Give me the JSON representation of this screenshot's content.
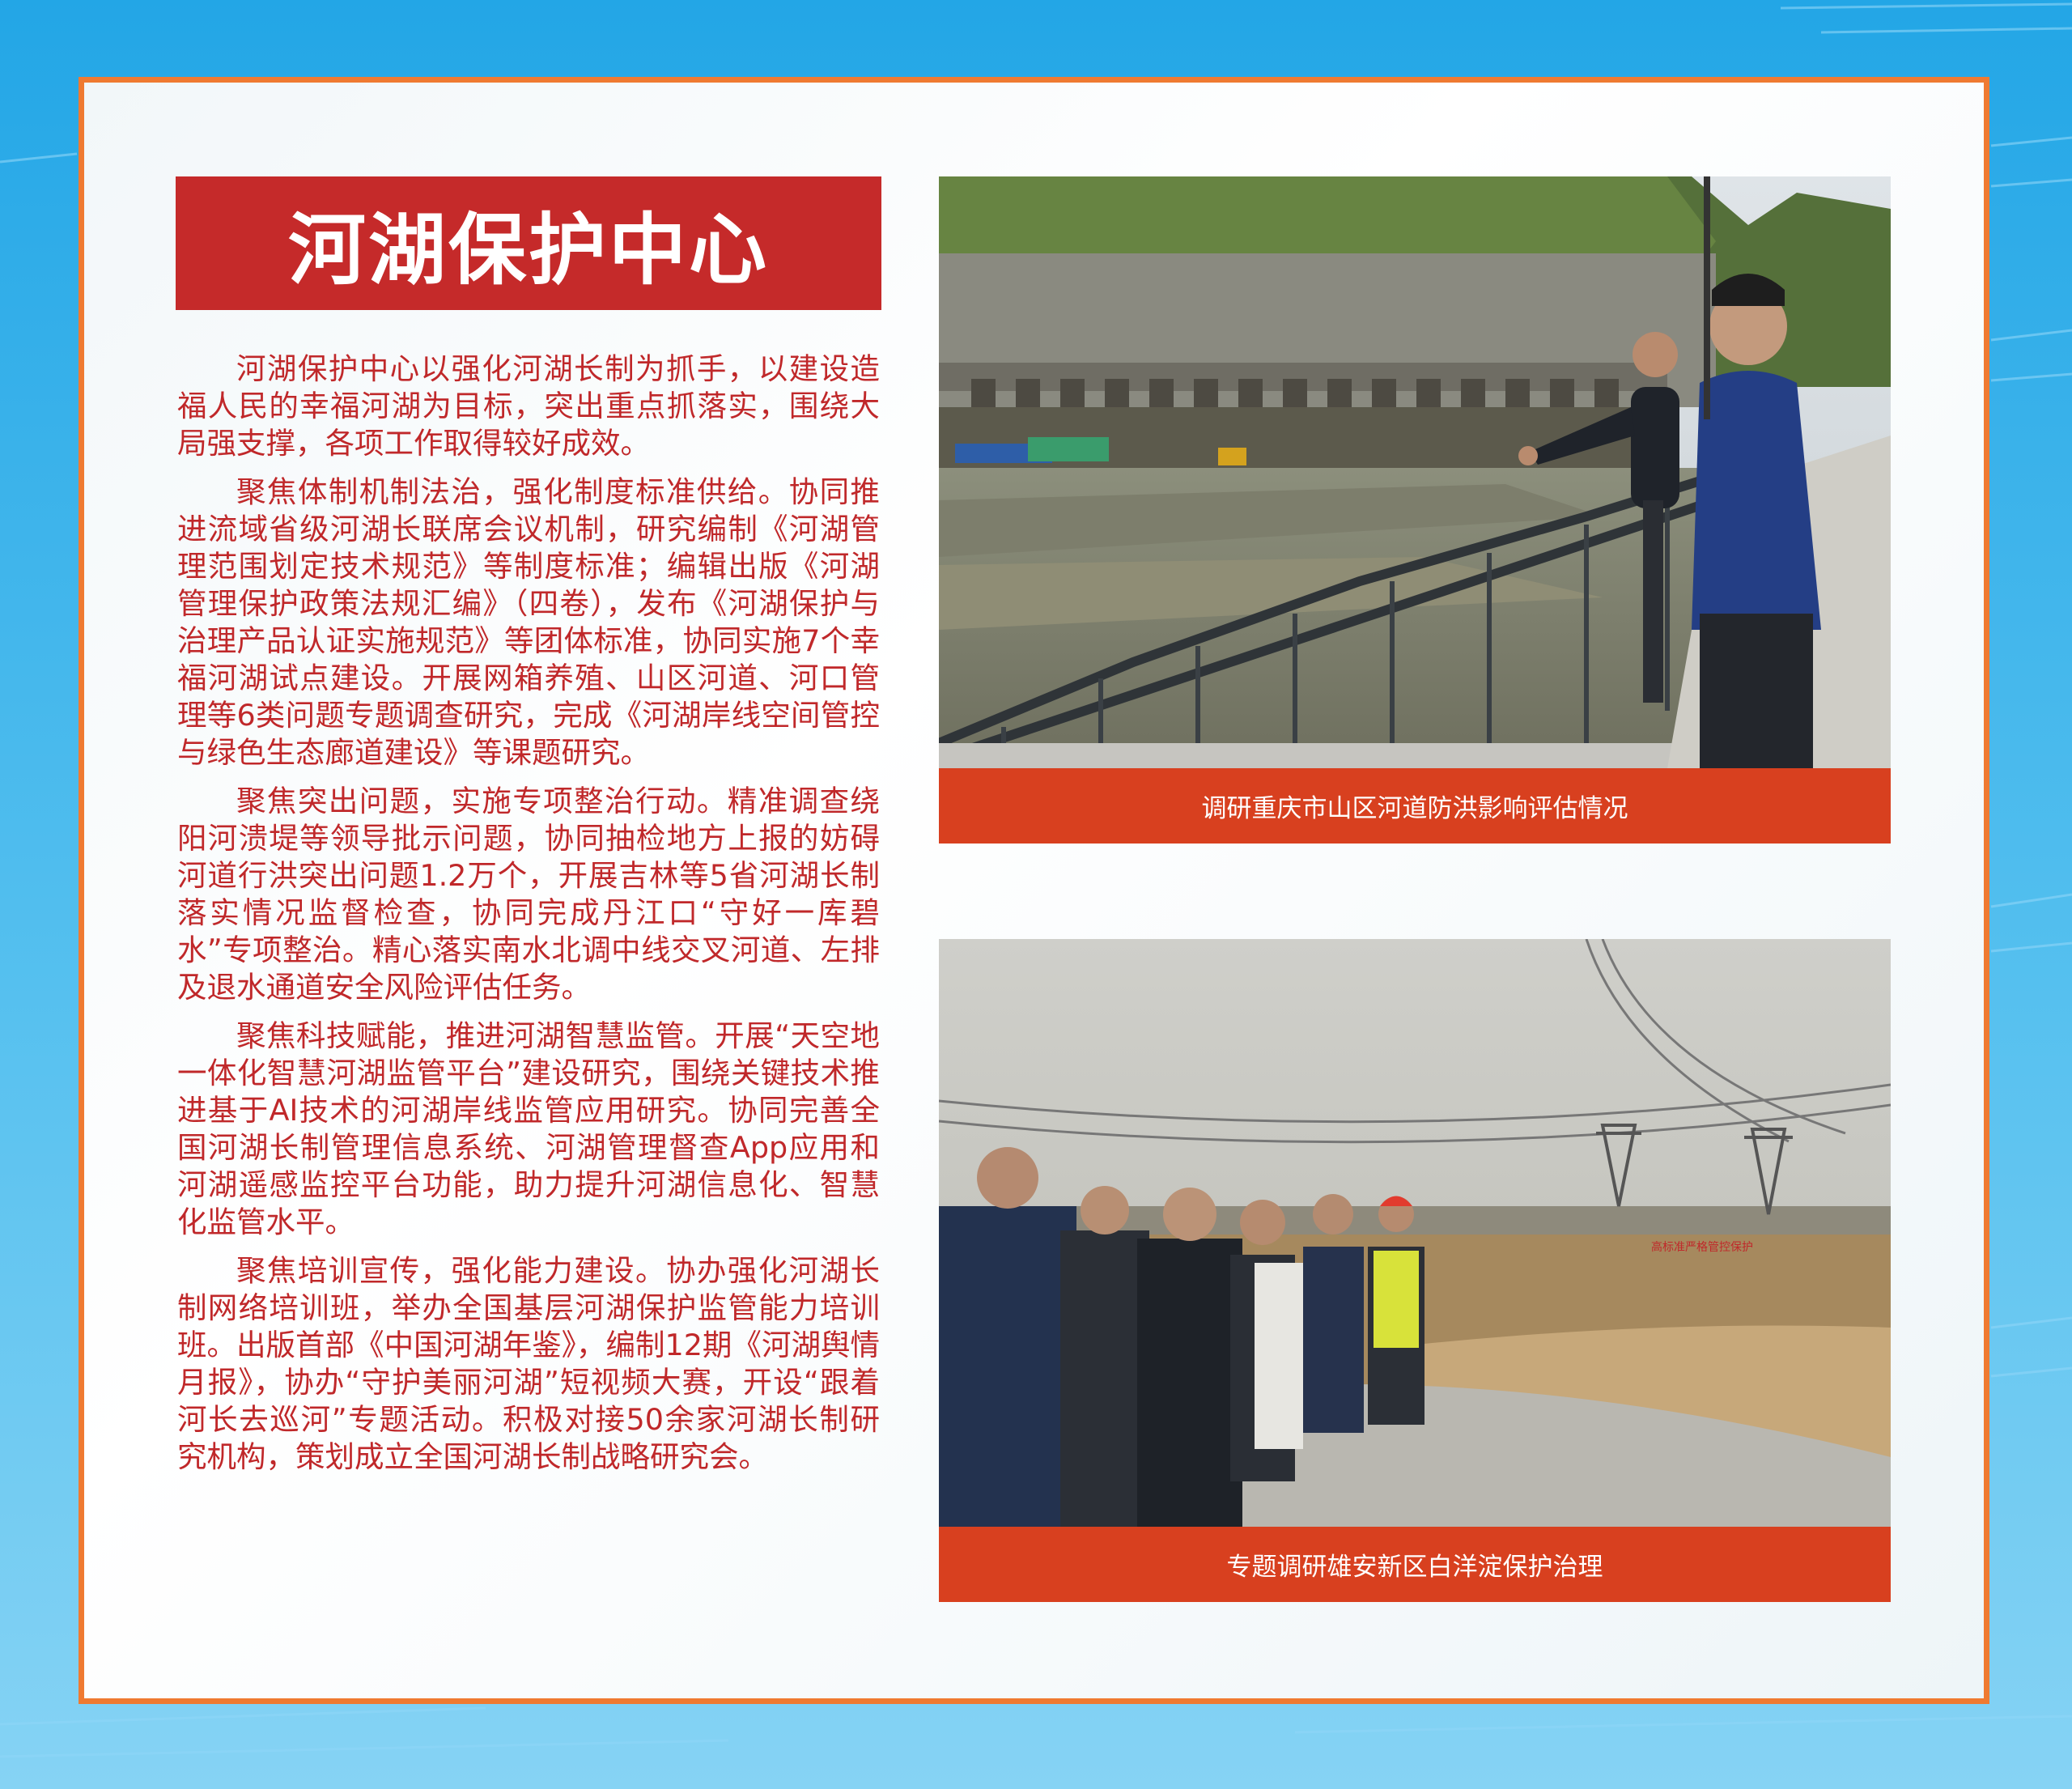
{
  "title": "河湖保护中心",
  "paragraphs": [
    "河湖保护中心以强化河湖长制为抓手，以建设造福人民的幸福河湖为目标，突出重点抓落实，围绕大局强支撑，各项工作取得较好成效。",
    "聚焦体制机制法治，强化制度标准供给。协同推进流域省级河湖长联席会议机制，研究编制《河湖管理范围划定技术规范》等制度标准；编辑出版《河湖管理保护政策法规汇编》（四卷），发布《河湖保护与治理产品认证实施规范》等团体标准，协同实施7个幸福河湖试点建设。开展网箱养殖、山区河道、河口管理等6类问题专题调查研究，完成《河湖岸线空间管控与绿色生态廊道建设》等课题研究。",
    "聚焦突出问题，实施专项整治行动。精准调查绕阳河溃堤等领导批示问题，协同抽检地方上报的妨碍河道行洪突出问题1.2万个，开展吉林等5省河湖长制落实情况监督检查，协同完成丹江口“守好一库碧水”专项整治。精心落实南水北调中线交叉河道、左排及退水通道安全风险评估任务。",
    "聚焦科技赋能，推进河湖智慧监管。开展“天空地一体化智慧河湖监管平台”建设研究，围绕关键技术推进基于AI技术的河湖岸线监管应用研究。协同完善全国河湖长制管理信息系统、河湖管理督查App应用和河湖遥感监控平台功能，助力提升河湖信息化、智慧化监管水平。",
    "聚焦培训宣传，强化能力建设。协办强化河湖长制网络培训班，举办全国基层河湖保护监管能力培训班。出版首部《中国河湖年鉴》，编制12期《河湖舆情月报》，协办“守护美丽河湖”短视频大赛，开设“跟着河长去巡河”专题活动。积极对接50余家河湖长制研究机构，策划成立全国河湖长制战略研究会。"
  ],
  "photos": [
    {
      "caption": "调研重庆市山区河道防洪影响评估情况"
    },
    {
      "caption": "专题调研雄安新区白洋淀保护治理",
      "sign_text": "高标准严格管控保护"
    }
  ],
  "colors": {
    "title_bg": "#c52a2a",
    "text": "#c0282a",
    "caption_bg": "#d8401f",
    "frame": "#ef7a31",
    "background": "#2aa9e8"
  }
}
